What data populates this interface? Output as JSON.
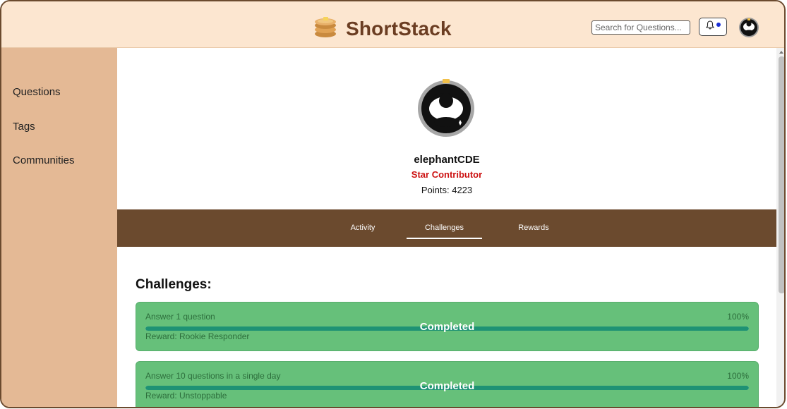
{
  "app": {
    "brand_name": "ShortStack"
  },
  "header": {
    "search_placeholder": "Search for Questions...",
    "notification_indicator_color": "#1a2fd6"
  },
  "sidebar": {
    "items": [
      {
        "label": "Questions"
      },
      {
        "label": "Tags"
      },
      {
        "label": "Communities"
      }
    ]
  },
  "profile": {
    "username": "elephantCDE",
    "rank": "Star Contributor",
    "points_text": "Points: 4223"
  },
  "tabs": [
    {
      "label": "Activity",
      "active": false
    },
    {
      "label": "Challenges",
      "active": true
    },
    {
      "label": "Rewards",
      "active": false
    }
  ],
  "challenges": {
    "title": "Challenges:",
    "items": [
      {
        "title": "Answer 1 question",
        "percent": "100%",
        "progress": 1.0,
        "status": "Completed",
        "reward": "Reward: Rookie Responder"
      },
      {
        "title": "Answer 10 questions in a single day",
        "percent": "100%",
        "progress": 1.0,
        "status": "Completed",
        "reward": "Reward: Unstoppable"
      }
    ]
  },
  "colors": {
    "header_bg": "#fce6d0",
    "sidebar_bg": "#e4b995",
    "tabbar_bg": "#6b4a2e",
    "rank_color": "#cc1111",
    "card_bg": "#66c07a",
    "progress_fill": "#1e9274"
  }
}
